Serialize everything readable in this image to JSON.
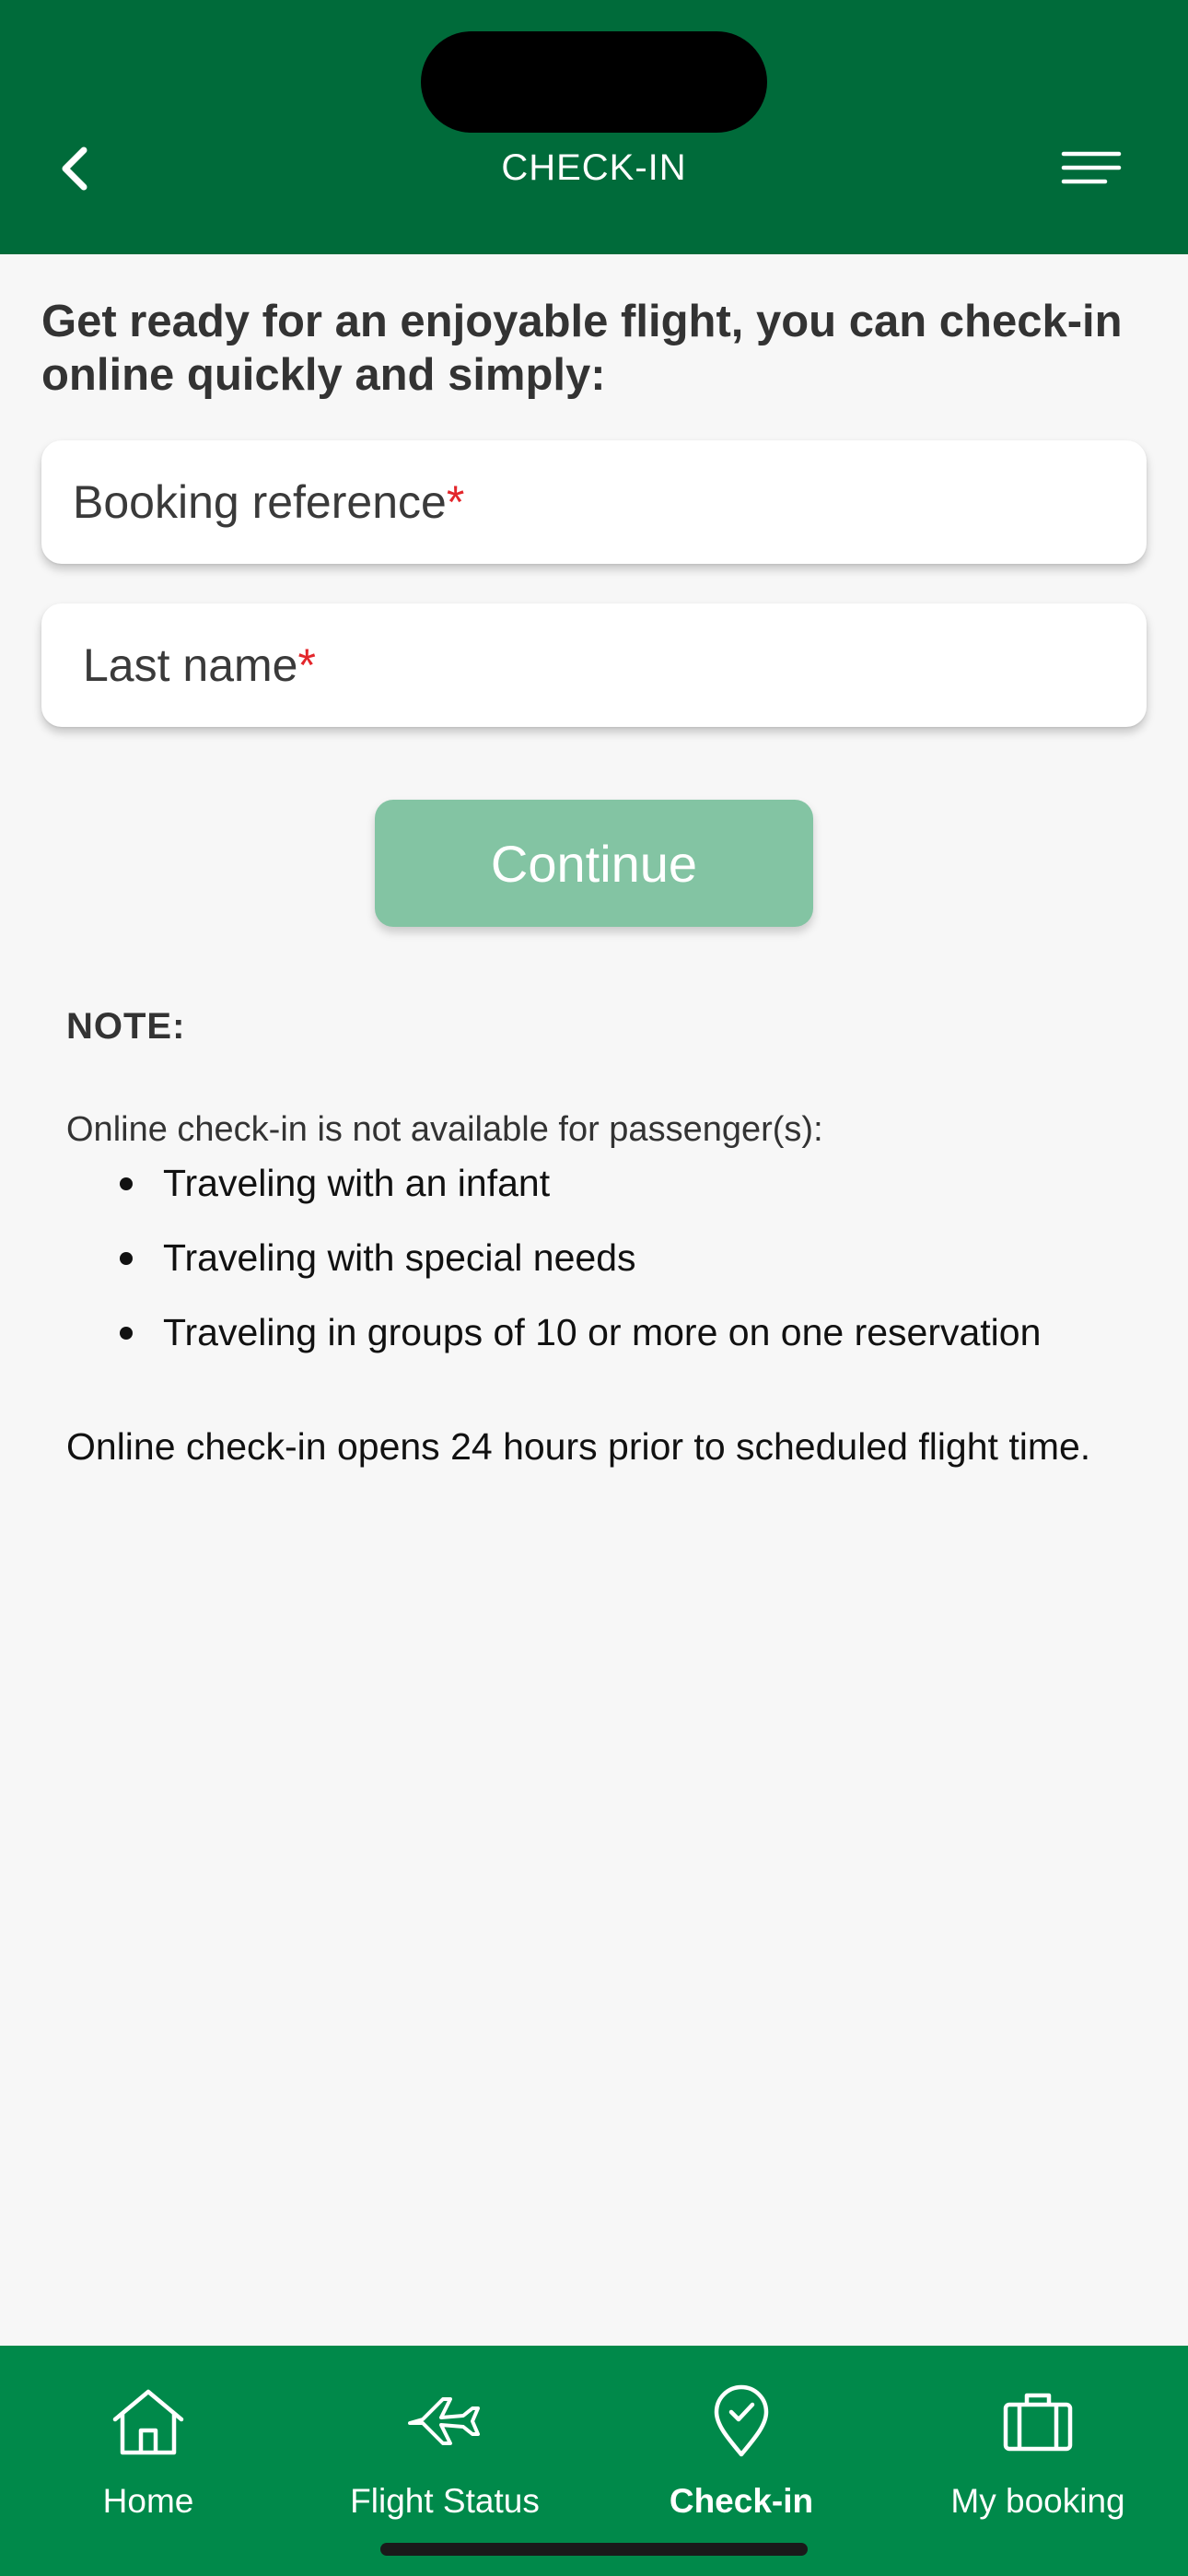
{
  "header": {
    "title": "CHECK-IN",
    "back_icon": "chevron-left-icon",
    "menu_icon": "menu-icon",
    "background_color": "#006b3a"
  },
  "intro": "Get ready for an enjoyable flight, you can check-in online quickly and simply:",
  "form": {
    "booking_reference": {
      "label": "Booking reference",
      "required_mark": "*",
      "value": ""
    },
    "last_name": {
      "label": "Last name",
      "required_mark": "*",
      "value": ""
    },
    "continue_label": "Continue",
    "continue_color": "#83c4a3"
  },
  "note": {
    "title": "NOTE:",
    "intro": "Online check-in is not available for passenger(s):",
    "items": [
      "Traveling with an infant",
      "Traveling with special needs",
      "Traveling in groups of 10 or more on one reservation"
    ],
    "footer": "Online check-in opens 24 hours prior to scheduled flight time."
  },
  "tabs": [
    {
      "label": "Home",
      "icon": "home-icon",
      "active": false
    },
    {
      "label": "Flight Status",
      "icon": "airplane-icon",
      "active": false
    },
    {
      "label": "Check-in",
      "icon": "location-check-icon",
      "active": true
    },
    {
      "label": "My booking",
      "icon": "briefcase-icon",
      "active": false
    }
  ],
  "colors": {
    "tabbar": "#00894a",
    "required": "#e3262b"
  }
}
